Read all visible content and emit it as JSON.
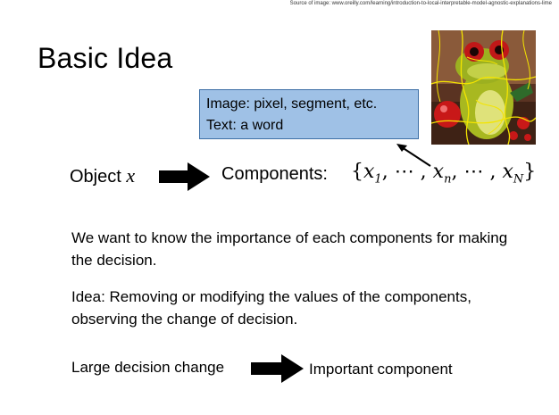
{
  "source_note": "Source of image: www.oreilly.com/learning/introduction-to-local-interpretable-model-agnostic-explanations-lime",
  "title": "Basic Idea",
  "callout": {
    "line1": "Image: pixel, segment, etc.",
    "line2": "Text: a word"
  },
  "object": {
    "label": "Object",
    "var": "x"
  },
  "components": {
    "label": "Components:",
    "open": "{",
    "x1_base": "x",
    "x1_sub": "1",
    "sep1": ", ⋯ , ",
    "xn_base": "x",
    "xn_sub": "n",
    "sep2": ", ⋯ , ",
    "xN_base": "x",
    "xN_sub": "N",
    "close": "}"
  },
  "paragraph1": "We want to know the importance of each components for making the decision.",
  "paragraph2": "Idea: Removing or modifying the values of the components,  observing the change of decision.",
  "large_change": "Large decision change",
  "important_component": "Important component",
  "colors": {
    "callout_fill": "#9fc1e6",
    "callout_border": "#3d6fa6",
    "arrow": "#000000"
  }
}
